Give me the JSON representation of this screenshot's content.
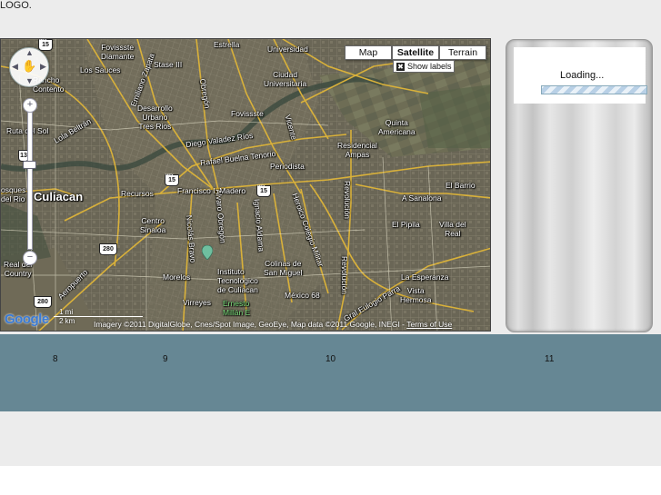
{
  "header": {
    "logo_text": "LOGO."
  },
  "map": {
    "map_types": [
      {
        "label": "Map",
        "selected": false
      },
      {
        "label": "Satellite",
        "selected": true
      },
      {
        "label": "Terrain",
        "selected": false
      }
    ],
    "show_labels": {
      "label": "Show labels",
      "checked": true
    },
    "zoom": {
      "in": "+",
      "out": "−"
    },
    "brand": "Google",
    "scale": {
      "top": "1 mi",
      "bottom": "2 km"
    },
    "attribution": "Imagery ©2011 DigitalGlobe, Cnes/Spot Image, GeoEye, Map data ©2011 Google, INEGI - ",
    "terms_link": "Terms of Use",
    "highway_shields": [
      "15",
      "15",
      "15",
      "280",
      "280",
      "13"
    ],
    "place_labels": {
      "fovissste_diamante": "Fovissste\nDiamante",
      "estrella": "Estrella",
      "universidad": "Universidad",
      "los_sauces": "Los Sauces",
      "stase": "Stase III",
      "ciudad_universitaria": "Ciudad\nUniversitaria",
      "rancho_contento": "Rancho\nContento",
      "desarrollo": "Desarrollo\nUrbano\nTres Rios",
      "fovissste": "Fovissste",
      "quinta_americana": "Quinta\nAmericana",
      "ruta_sol": "Ruta del Sol",
      "residencial_ampas": "Residencial\nAmpas",
      "periodista": "Periodista",
      "culiacan": "Culiacan",
      "recursos": "Recursos",
      "el_barrio": "El Barrio",
      "centro_sinaloa": "Centro\nSinaloa",
      "el_pipila": "El Pipila",
      "villa_del_real": "Villa del\nReal",
      "real_country": "Real del\nCountry",
      "morelos": "Morelos",
      "instituto": "Instituto\nTecnologico\nde Culiacan",
      "colinas": "Colinas de\nSan Miguel",
      "la_esperanza": "La Esperanza",
      "virreyes": "Virreyes",
      "mexico68": "México 68",
      "vista_hermosa": "Vista\nHermosa",
      "ernesto": "Ernesto\nMillán E",
      "bosques": "osques\ndel Rio",
      "cuellacan": "uliacan",
      "a_sanalona": "A Sanalona",
      "rafael": "Rafael Buelna Tenorio",
      "diego": "Diego Valadez Ríos",
      "francisco": "Francisco I. Madero",
      "los_belmar": "Lola Beltrán",
      "blvd_emiliano": "Emiliano Zapata",
      "aeropuerto": "Aeropuerto",
      "gral_eulogio": "Gral Eulogio Parra",
      "revolucion": "Revolución",
      "obregon": "Álvaro Obregón",
      "ignacio": "Ignacio Aldama",
      "heroico": "Heroico Colegio Militar",
      "nicolas": "Nicolás Bravo",
      "el_dorado": "Obregón",
      "vicente": "Vicente"
    }
  },
  "loading_panel": {
    "text": "Loading..."
  },
  "band": {
    "numbers": [
      "8",
      "9",
      "10",
      "11"
    ]
  }
}
